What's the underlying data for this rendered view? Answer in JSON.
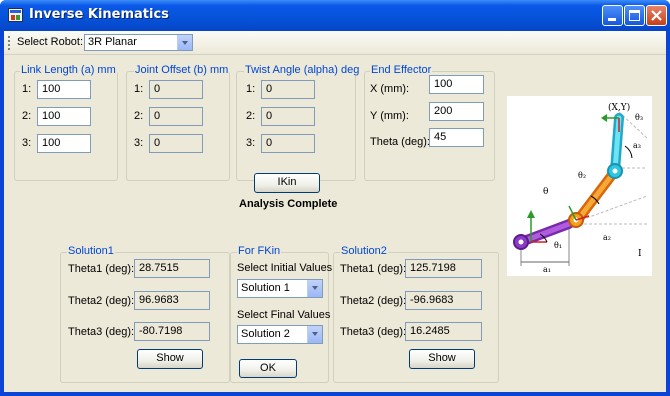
{
  "window": {
    "title": "Inverse Kinematics"
  },
  "toolbar": {
    "select_robot_label": "Select Robot:",
    "robot_value": "3R Planar"
  },
  "link_length": {
    "title": "Link Length (a) mm",
    "rows": [
      {
        "label": "1:",
        "value": "100"
      },
      {
        "label": "2:",
        "value": "100"
      },
      {
        "label": "3:",
        "value": "100"
      }
    ]
  },
  "joint_offset": {
    "title": "Joint Offset (b) mm",
    "rows": [
      {
        "label": "1:",
        "value": "0"
      },
      {
        "label": "2:",
        "value": "0"
      },
      {
        "label": "3:",
        "value": "0"
      }
    ]
  },
  "twist_angle": {
    "title": "Twist Angle (alpha) deg",
    "rows": [
      {
        "label": "1:",
        "value": "0"
      },
      {
        "label": "2:",
        "value": "0"
      },
      {
        "label": "3:",
        "value": "0"
      }
    ]
  },
  "end_effector": {
    "title": "End Effector",
    "x_label": "X (mm):",
    "x_value": "100",
    "y_label": "Y (mm):",
    "y_value": "200",
    "theta_label": "Theta (deg):",
    "theta_value": "45"
  },
  "ikin": {
    "button_label": "IKin",
    "status": "Analysis Complete"
  },
  "solution1": {
    "title": "Solution1",
    "theta1_label": "Theta1 (deg):",
    "theta1": "28.7515",
    "theta2_label": "Theta2 (deg):",
    "theta2": "96.9683",
    "theta3_label": "Theta3 (deg):",
    "theta3": "-80.7198",
    "show_label": "Show"
  },
  "fkin": {
    "title": "For FKin",
    "initial_label": "Select Initial Values",
    "initial_value": "Solution 1",
    "final_label": "Select Final Values",
    "final_value": "Solution 2",
    "ok_label": "OK"
  },
  "solution2": {
    "title": "Solution2",
    "theta1_label": "Theta1 (deg):",
    "theta1": "125.7198",
    "theta2_label": "Theta2 (deg):",
    "theta2": "-96.9683",
    "theta3_label": "Theta3 (deg):",
    "theta3": "16.2485",
    "show_label": "Show"
  },
  "diagram": {
    "xy_label": "(X,Y)",
    "theta_label": "θ",
    "theta1": "θ₁",
    "theta2": "θ₂",
    "theta3": "θ₃",
    "a1": "a₁",
    "a2": "a₂",
    "a3": "a₃",
    "mark": "I"
  }
}
